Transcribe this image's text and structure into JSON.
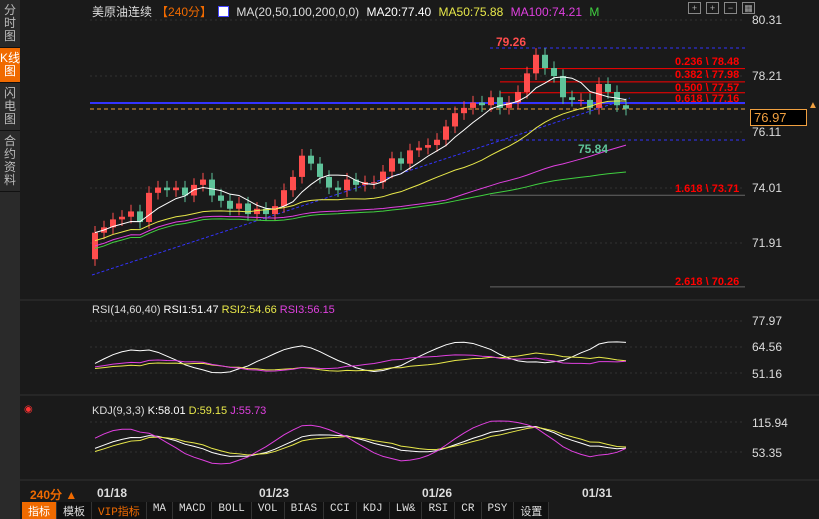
{
  "sidebar": {
    "items": [
      {
        "label": "分时图"
      },
      {
        "label": "K线图",
        "active": true
      },
      {
        "label": "闪电图"
      },
      {
        "label": "合约资料"
      }
    ]
  },
  "header": {
    "symbol": "美原油连续",
    "period": "【240分】",
    "ma_params": "MA(20,50,100,200,0,0)",
    "ma20": "MA20:77.40",
    "ma50": "MA50:75.88",
    "ma100": "MA100:74.21",
    "m": "M"
  },
  "price_axis": [
    "80.31",
    "78.21",
    "76.11",
    "74.01",
    "71.91"
  ],
  "current_price": "76.97",
  "high_label": "79.26",
  "low_label": "75.84",
  "fib": [
    "0.236 \\ 78.48",
    "0.382 \\ 77.98",
    "0.500 \\ 77.57",
    "0.618 \\ 77.16",
    "1.618 \\ 73.71",
    "2.618 \\ 70.26"
  ],
  "rsi": {
    "title": "RSI(14,60,40)",
    "rsi1": "RSI1:51.47",
    "rsi2": "RSI2:54.66",
    "rsi3": "RSI3:56.15",
    "axis": [
      "77.97",
      "64.56",
      "51.16"
    ]
  },
  "kdj": {
    "title": "KDJ(9,3,3)",
    "k": "K:58.01",
    "d": "D:59.15",
    "j": "J:55.73",
    "axis": [
      "115.94",
      "53.35"
    ]
  },
  "period_selector": "240分 ▲",
  "dates": [
    "01/18",
    "01/23",
    "01/26",
    "01/31"
  ],
  "bottom_tabs": [
    "指标",
    "模板",
    "VIP指标",
    "MA",
    "MACD",
    "BOLL",
    "VOL",
    "BIAS",
    "CCI",
    "KDJ",
    "LW&",
    "RSI",
    "CR",
    "PSY",
    "设置"
  ],
  "colors": {
    "up": "#ff4d4d",
    "down": "#5fc39a",
    "ma20": "#ffffff",
    "ma50": "#e8e84a",
    "ma100": "#e040e0",
    "ma200": "#40d040",
    "accent": "#f06a00"
  },
  "chart_data": {
    "type": "candlestick",
    "closes": [
      72.3,
      72.5,
      72.8,
      72.9,
      73.1,
      72.7,
      73.8,
      74.0,
      73.9,
      74.0,
      73.7,
      74.1,
      74.3,
      73.7,
      73.5,
      73.2,
      73.4,
      73.0,
      73.2,
      73.0,
      73.3,
      73.9,
      74.4,
      75.2,
      74.9,
      74.4,
      74.0,
      73.9,
      74.3,
      74.1,
      74.2,
      74.2,
      74.6,
      75.1,
      74.9,
      75.4,
      75.5,
      75.6,
      75.8,
      76.3,
      76.8,
      77.0,
      77.2,
      77.1,
      77.4,
      77.0,
      77.2,
      77.6,
      78.3,
      79.0,
      78.5,
      78.2,
      77.4,
      77.3,
      77.3,
      77.0,
      77.9,
      77.6,
      77.1,
      76.97
    ],
    "first_open": 71.3,
    "ylim": [
      70.0,
      80.31
    ]
  }
}
